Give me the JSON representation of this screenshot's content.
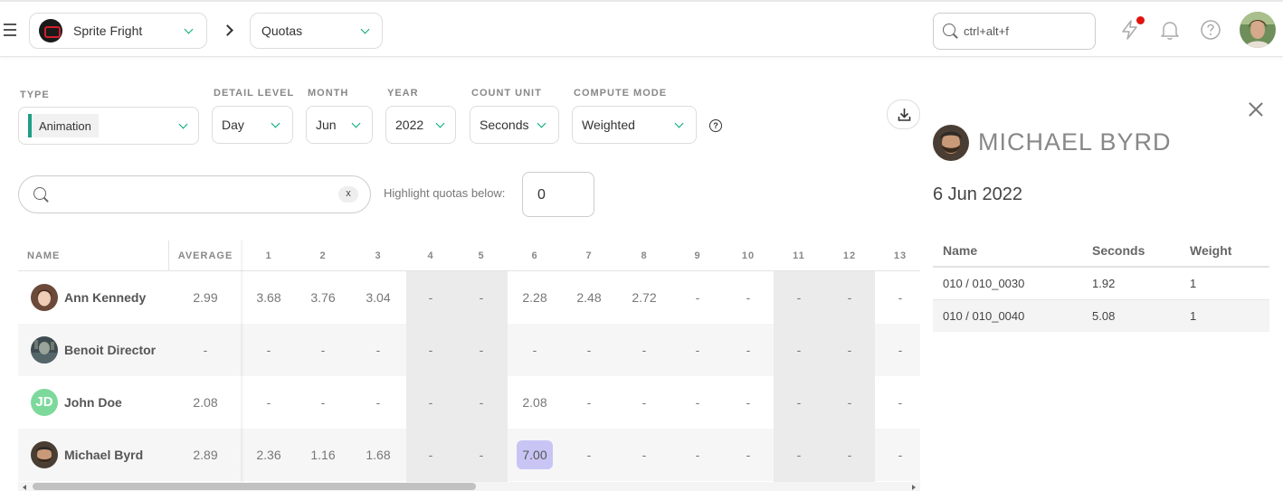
{
  "topbar": {
    "production": "Sprite Fright",
    "page": "Quotas",
    "search_placeholder": "ctrl+alt+f"
  },
  "filters": {
    "type": {
      "label": "TYPE",
      "value": "Animation"
    },
    "detail_level": {
      "label": "DETAIL LEVEL",
      "value": "Day"
    },
    "month": {
      "label": "MONTH",
      "value": "Jun"
    },
    "year": {
      "label": "YEAR",
      "value": "2022"
    },
    "count_unit": {
      "label": "COUNT UNIT",
      "value": "Seconds"
    },
    "compute_mode": {
      "label": "COMPUTE MODE",
      "value": "Weighted"
    },
    "help": "?"
  },
  "search": {
    "clear": "x",
    "highlight_label": "Highlight quotas below:",
    "highlight_value": "0"
  },
  "table": {
    "headers": {
      "name": "NAME",
      "average": "AVERAGE",
      "days": [
        "1",
        "2",
        "3",
        "4",
        "5",
        "6",
        "7",
        "8",
        "9",
        "10",
        "11",
        "12",
        "13"
      ]
    },
    "rows": [
      {
        "name": "Ann Kennedy",
        "average": "2.99",
        "days": [
          "3.68",
          "3.76",
          "3.04",
          "-",
          "-",
          "2.28",
          "2.48",
          "2.72",
          "-",
          "-",
          "-",
          "-",
          "-"
        ]
      },
      {
        "name": "Benoit Director",
        "average": "-",
        "days": [
          "-",
          "-",
          "-",
          "-",
          "-",
          "-",
          "-",
          "-",
          "-",
          "-",
          "-",
          "-",
          "-"
        ]
      },
      {
        "name": "John Doe",
        "initials": "JD",
        "average": "2.08",
        "days": [
          "-",
          "-",
          "-",
          "-",
          "-",
          "2.08",
          "-",
          "-",
          "-",
          "-",
          "-",
          "-",
          "-"
        ]
      },
      {
        "name": "Michael Byrd",
        "average": "2.89",
        "days": [
          "2.36",
          "1.16",
          "1.68",
          "-",
          "-",
          "7.00",
          "-",
          "-",
          "-",
          "-",
          "-",
          "-",
          "-"
        ]
      }
    ]
  },
  "detail": {
    "name": "MICHAEL BYRD",
    "date": "6 Jun 2022",
    "headers": {
      "name": "Name",
      "seconds": "Seconds",
      "weight": "Weight"
    },
    "rows": [
      {
        "name": "010 / 010_0030",
        "seconds": "1.92",
        "weight": "1"
      },
      {
        "name": "010 / 010_0040",
        "seconds": "5.08",
        "weight": "1"
      }
    ]
  },
  "icons": [
    "menu-icon",
    "chevron-down-icon",
    "chevron-right-icon",
    "search-icon",
    "lightning-icon",
    "bell-icon",
    "help-icon",
    "download-icon",
    "close-icon"
  ],
  "colors": {
    "accent": "#00a87a",
    "type_bar": "#1f9e84",
    "highlight": "#c8c5f5",
    "notif": "#e0140c",
    "jd_avatar": "#7dd99b"
  }
}
